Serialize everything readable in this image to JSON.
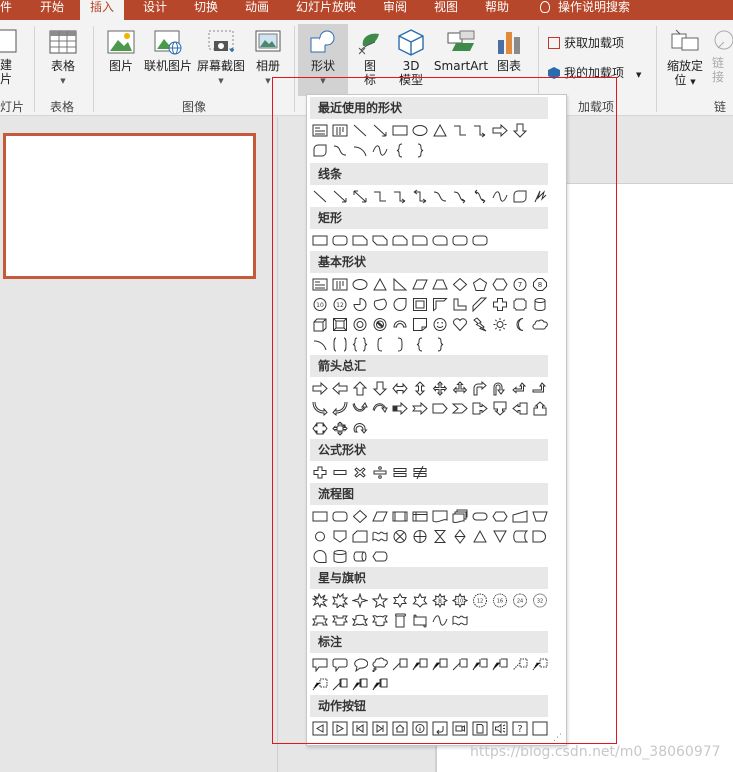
{
  "tabs": [
    {
      "label": "件",
      "active": false
    },
    {
      "label": "开始",
      "active": false
    },
    {
      "label": "插入",
      "active": true
    },
    {
      "label": "设计",
      "active": false
    },
    {
      "label": "切换",
      "active": false
    },
    {
      "label": "动画",
      "active": false
    },
    {
      "label": "幻灯片放映",
      "active": false
    },
    {
      "label": "审阅",
      "active": false
    },
    {
      "label": "视图",
      "active": false
    },
    {
      "label": "帮助",
      "active": false
    },
    {
      "label": "操作说明搜索",
      "active": false
    }
  ],
  "ribbon": {
    "new_slide": {
      "line1": "建",
      "line2": "片"
    },
    "group_slides": "灯片",
    "table": {
      "label": "表格"
    },
    "group_table": "表格",
    "picture": "图片",
    "online_picture": "联机图片",
    "screenshot": "屏幕截图",
    "album": "相册",
    "group_images": "图像",
    "shapes": "形状",
    "icons": {
      "line1": "图",
      "line2": "标"
    },
    "model3d": {
      "line1": "3D",
      "line2": "模型"
    },
    "smartart": "SmartArt",
    "chart": "图表",
    "get_addins": "获取加载项",
    "my_addins": "我的加载项",
    "group_addins": "加载项",
    "zoom": {
      "line1": "缩放定",
      "line2": "位"
    },
    "link": {
      "line1": "链",
      "line2": "接"
    },
    "group_links": "链"
  },
  "panel": {
    "sections": [
      {
        "title": "最近使用的形状",
        "rows": [
          [
            "textbox",
            "vtextbox",
            "line",
            "arrowline",
            "rect",
            "oval",
            "triangle",
            "elbow",
            "elbowarrow",
            "rightarrow",
            "downarrow"
          ],
          [
            "roundcorner",
            "curvedconn",
            "arc",
            "wave",
            "lbrace",
            "rbrace"
          ]
        ]
      },
      {
        "title": "线条",
        "rows": [
          [
            "line",
            "arrowline",
            "dblarrowline",
            "elbow",
            "elbowarrow",
            "dblelbow",
            "curvedconn",
            "curvedarrow",
            "curveddbl",
            "wave",
            "roundcorner",
            "scribble"
          ]
        ]
      },
      {
        "title": "矩形",
        "rows": [
          [
            "rect",
            "roundrect",
            "snip1",
            "snip2",
            "snipround",
            "round1",
            "round2",
            "roundrect",
            "roundrect"
          ]
        ]
      },
      {
        "title": "基本形状",
        "rows": [
          [
            "textbox",
            "vtextbox",
            "oval",
            "triangle",
            "rtriangle",
            "parallelogram",
            "trapezoid",
            "diamond",
            "pentagon",
            "hexagon",
            "heptagon",
            "octagon"
          ],
          [
            "decagon",
            "dodecagon",
            "pie",
            "chord",
            "teardrop",
            "frame",
            "halfframe",
            "lshape",
            "diagstripe",
            "cross",
            "plaque",
            "can"
          ],
          [
            "cube",
            "bevel",
            "donut",
            "nosymbol",
            "blockarc",
            "foldedcorner",
            "smiley",
            "heart",
            "lightning",
            "sun",
            "moon",
            "cloud"
          ],
          [
            "arc",
            "bracketpair",
            "bracepair",
            "lbracket",
            "rbracket",
            "lbrace",
            "rbrace"
          ]
        ]
      },
      {
        "title": "箭头总汇",
        "rows": [
          [
            "rightarrow",
            "leftarrow",
            "uparrow",
            "downarrow",
            "lrarrow",
            "udarrow",
            "quadarrow",
            "lruparrow",
            "bentarrow",
            "uturn",
            "leftuparrow",
            "bentuparrow"
          ],
          [
            "curvedright",
            "curvedleft",
            "curvedup",
            "curveddown",
            "stripedright",
            "notchedright",
            "pentagonarrow",
            "chevron",
            "rightcallout",
            "downcallout",
            "leftcallout",
            "upcallout"
          ],
          [
            "lrcallout",
            "quadcallout",
            "circulararrow"
          ]
        ]
      },
      {
        "title": "公式形状",
        "rows": [
          [
            "plus",
            "minus",
            "multiply",
            "divide",
            "equal",
            "notequal"
          ]
        ]
      },
      {
        "title": "流程图",
        "rows": [
          [
            "rect",
            "roundrect",
            "diamond",
            "parallelogram",
            "predefined",
            "internalstorage",
            "document",
            "multidoc",
            "terminator",
            "preparation",
            "manualinput",
            "manualop"
          ],
          [
            "circle",
            "offpage",
            "card",
            "punchedtape",
            "summing",
            "or",
            "collate",
            "sort",
            "extract",
            "merge",
            "storeddata",
            "delay"
          ],
          [
            "seqaccess",
            "magdisk",
            "directaccess",
            "display"
          ]
        ]
      },
      {
        "title": "星与旗帜",
        "rows": [
          [
            "explosion1",
            "explosion2",
            "star4",
            "star5",
            "star6",
            "star7",
            "star8",
            "star10",
            "star12",
            "star16",
            "star24",
            "star32"
          ],
          [
            "ribbonup",
            "ribbondown",
            "curvedribbonup",
            "curvedribbondown",
            "verticalscroll",
            "horizontalscroll",
            "wave",
            "doublewave"
          ]
        ]
      },
      {
        "title": "标注",
        "rows": [
          [
            "rectcallout",
            "roundrectcallout",
            "ovalcallout",
            "cloudcallout",
            "linecallout1",
            "linecallout2",
            "linecallout3",
            "accentcallout1",
            "accentcallout2",
            "accentcallout3",
            "bordercallout1",
            "bordercallout2"
          ],
          [
            "bordercallout3",
            "accentborder1",
            "accentborder2",
            "accentborder3"
          ]
        ]
      },
      {
        "title": "动作按钮",
        "rows": [
          [
            "btnback",
            "btnforward",
            "btnbegin",
            "btnend",
            "btnhome",
            "btninfo",
            "btnreturn",
            "btnmovie",
            "btndocument",
            "btnsound",
            "btnhelp",
            "btncustom"
          ]
        ]
      }
    ]
  },
  "watermark": "https://blog.csdn.net/m0_38060977"
}
